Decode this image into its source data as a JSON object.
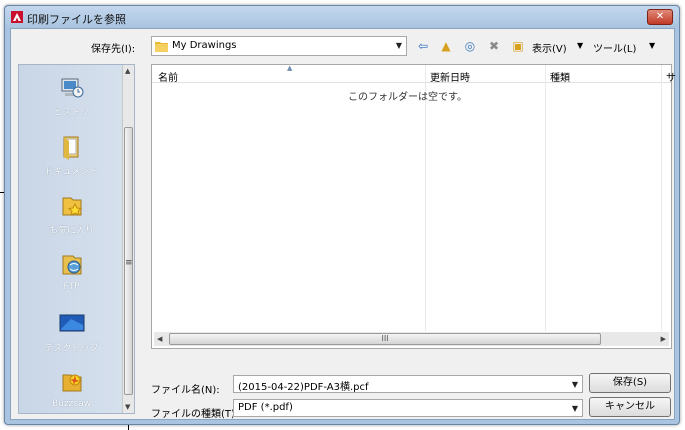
{
  "window": {
    "title": "印刷ファイルを参照",
    "close_glyph": "✕"
  },
  "save_in": {
    "label": "保存先(I):",
    "value": "My Drawings",
    "arrow": "▼"
  },
  "toolbar": {
    "back": "⇦",
    "up": "▲",
    "search": "◎",
    "delete": "✖",
    "new_folder": "▣",
    "views_label": "表示(V)",
    "views_arrow": "▼",
    "tools_label": "ツール(L)",
    "tools_arrow": "▼"
  },
  "places": [
    {
      "label": "ヒストリ",
      "icon": "history-icon"
    },
    {
      "label": "ドキュメント",
      "icon": "documents-icon"
    },
    {
      "label": "お気に入り",
      "icon": "favorites-icon"
    },
    {
      "label": "FTP",
      "icon": "ftp-icon"
    },
    {
      "label": "デスクトップ",
      "icon": "desktop-icon"
    },
    {
      "label": "Buzzsaw",
      "icon": "buzzsaw-icon"
    }
  ],
  "list": {
    "columns": [
      "名前",
      "更新日時",
      "種類",
      "サ"
    ],
    "empty_message": "このフォルダーは空です。",
    "hscroll_grip": "III"
  },
  "file_name": {
    "label": "ファイル名(N):",
    "value": "(2015-04-22)PDF-A3横.pcf"
  },
  "file_type": {
    "label": "ファイルの種類(T):",
    "value": "PDF (*.pdf)"
  },
  "buttons": {
    "save": "保存(S)",
    "cancel": "キャンセル"
  },
  "scroll": {
    "up": "▲",
    "down": "▼",
    "left": "◀",
    "right": "▶",
    "grip": "≡"
  },
  "colors": {
    "titlebar": "#a9c4e0",
    "close": "#c13a26",
    "places_panel": "#c9d6e6"
  }
}
